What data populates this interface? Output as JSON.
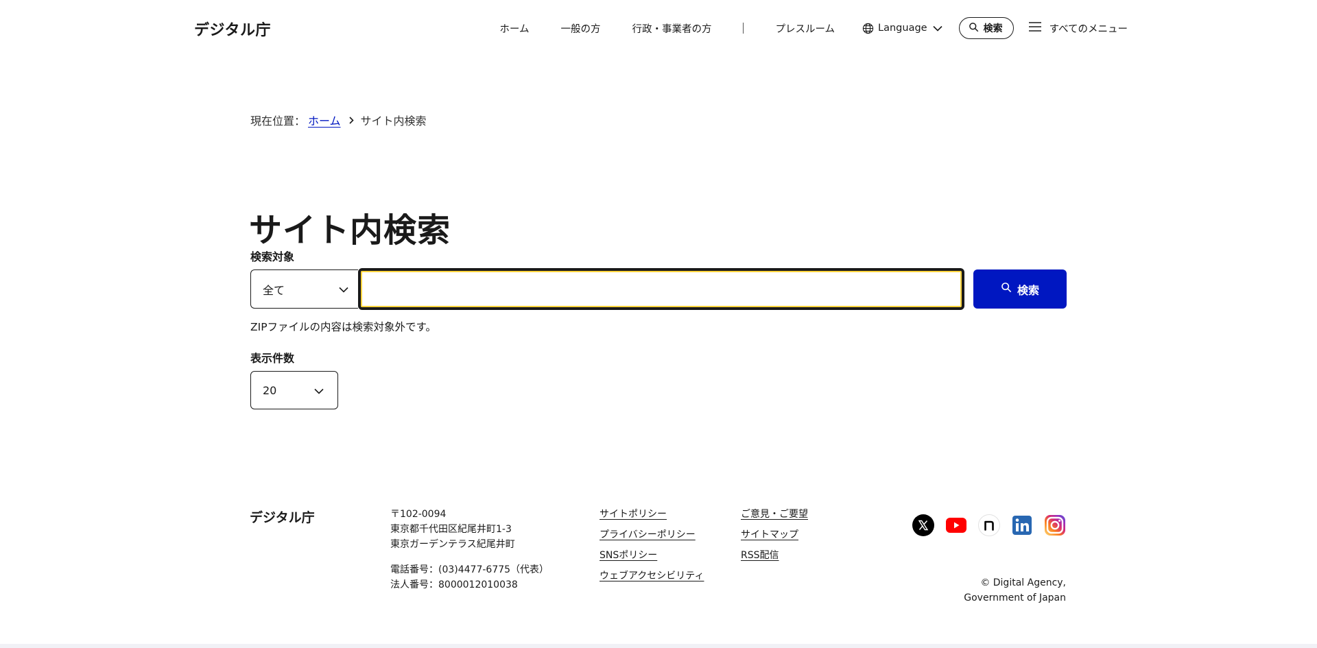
{
  "header": {
    "logo": "デジタル庁",
    "nav": {
      "home": "ホーム",
      "general": "一般の方",
      "business": "行政・事業者の方",
      "press": "プレスルーム",
      "language": "Language",
      "search": "検索",
      "all_menu": "すべてのメニュー"
    }
  },
  "breadcrumb": {
    "prefix": "現在位置：",
    "home": "ホーム",
    "current": "サイト内検索"
  },
  "main": {
    "title": "サイト内検索",
    "target_label": "検索対象",
    "target_selected": "全て",
    "search_value": "",
    "search_button": "検索",
    "note": "ZIPファイルの内容は検索対象外です。",
    "count_label": "表示件数",
    "count_selected": "20"
  },
  "footer": {
    "logo": "デジタル庁",
    "address": {
      "postal": "〒102-0094",
      "line1": "東京都千代田区紀尾井町1-3",
      "line2": "東京ガーデンテラス紀尾井町",
      "phone": "電話番号：(03)4477-6775（代表）",
      "corp_number": "法人番号：8000012010038"
    },
    "links_col1": {
      "site_policy": "サイトポリシー",
      "privacy_policy": "プライバシーポリシー",
      "sns_policy": "SNSポリシー",
      "accessibility": "ウェブアクセシビリティ"
    },
    "links_col2": {
      "feedback": "ご意見・ご要望",
      "sitemap": "サイトマップ",
      "rss": "RSS配信"
    },
    "social": [
      "x-icon",
      "youtube-icon",
      "note-icon",
      "linkedin-icon",
      "instagram-icon"
    ],
    "copyright_line1": "© Digital Agency,",
    "copyright_line2": "Government of Japan"
  },
  "colors": {
    "accent": "#0017c1",
    "focus_ring": "#ffd43d",
    "text": "#1a1a1a"
  }
}
